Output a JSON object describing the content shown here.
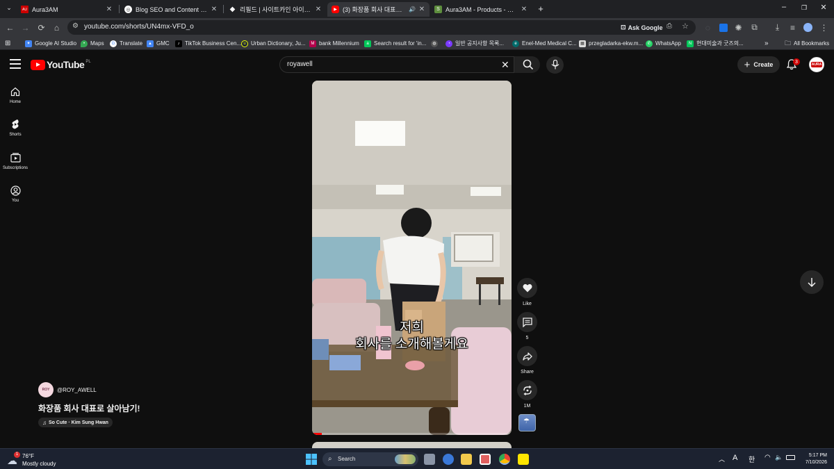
{
  "browser": {
    "tabs": [
      {
        "title": "Aura3AM",
        "favicon": "aura3am-favicon",
        "active": false
      },
      {
        "title": "Blog SEO and Content Help",
        "favicon": "chat-favicon",
        "active": false
      },
      {
        "title": "리필드 | 사이트카인 아이래쉬 ·",
        "favicon": "diamond-favicon",
        "active": false
      },
      {
        "title": "(3) 화장품 회사 대표로 살아",
        "favicon": "youtube-favicon",
        "active": true
      },
      {
        "title": "Aura3AM - Products - Shopify",
        "favicon": "shopify-favicon",
        "active": false
      }
    ],
    "url": "youtube.com/shorts/UN4mx-VFD_o",
    "ask_google_label": "Ask Google",
    "bookmarks": [
      "Google AI Studio",
      "Maps",
      "Translate",
      "GMC",
      "TikTok Business Cen...",
      "Urban Dictionary, Ju...",
      "bank Millennium",
      "Search result for 'in...",
      "",
      "일반 공지사항 목록...",
      "Enel-Med Medical C...",
      "przegladarka-ekw.m...",
      "WhatsApp",
      "현대미술과 굿즈의..."
    ],
    "all_bookmarks_label": "All Bookmarks"
  },
  "youtube": {
    "logo_text": "YouTube",
    "country_code": "PL",
    "search_query": "royawell",
    "create_label": "Create",
    "notification_count": "3",
    "account_avatar_text": "AURA",
    "sidebar": [
      {
        "label": "Home",
        "icon": "home-icon"
      },
      {
        "label": "Shorts",
        "icon": "shorts-icon"
      },
      {
        "label": "Subscriptions",
        "icon": "subscriptions-icon"
      },
      {
        "label": "You",
        "icon": "you-icon"
      }
    ],
    "short": {
      "caption_line1": "저희",
      "caption_line2": "회사를 소개해볼게요",
      "channel_handle": "@ROY_AWELL",
      "channel_avatar_text": "ROY",
      "title": "화장품 회사 대표로 살아남기!",
      "sound": "So Cute · Kim Sung Hwan"
    },
    "actions": [
      {
        "label": "Like",
        "icon": "heart-icon"
      },
      {
        "label": "5",
        "icon": "comment-icon"
      },
      {
        "label": "Share",
        "icon": "share-icon"
      },
      {
        "label": "1M",
        "icon": "remix-icon"
      }
    ]
  },
  "taskbar": {
    "weather_temp": "76°F",
    "weather_desc": "Mostly cloudy",
    "weather_badge": "1",
    "search_placeholder": "Search",
    "ime_label": "A",
    "lang_label": "한",
    "time": "5:17 PM",
    "date": "7/10/2026"
  },
  "colors": {
    "youtube_red": "#ff0000",
    "background": "#0f0f0f",
    "chip": "#272727"
  }
}
